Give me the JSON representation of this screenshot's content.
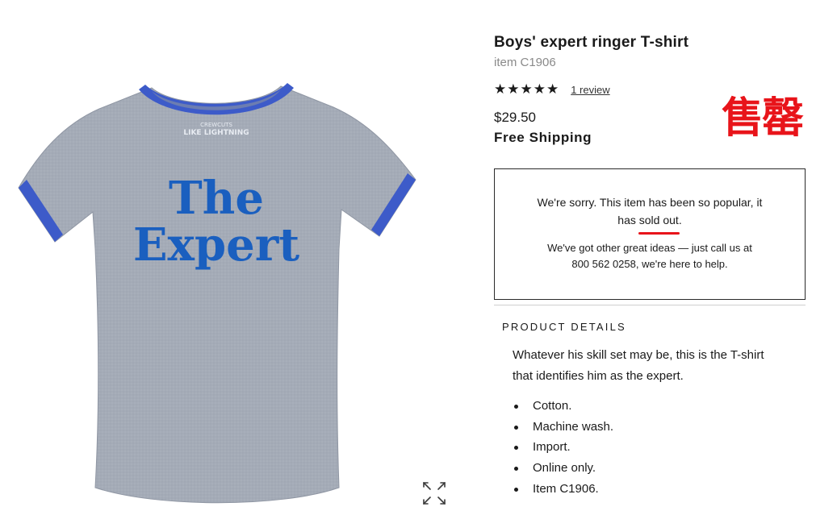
{
  "product": {
    "title": "Boys' expert ringer T-shirt",
    "item_code": "item C1906",
    "stars": "★★★★★",
    "rating": 5,
    "review_link": "1 review",
    "price": "$29.50",
    "shipping": "Free Shipping"
  },
  "stamp": "售罄",
  "soldout": {
    "line1_prefix": "We're sorry. This item has been so popular, it",
    "line2_prefix": "has ",
    "sold_out": "sold out",
    "line2_suffix": ".",
    "help_line1": "We've got other great ideas — just call us at",
    "help_line2": "800 562 0258, we're here to help."
  },
  "product_details": {
    "heading": "PRODUCT DETAILS",
    "description_line1": "Whatever his skill set may be, this is the T-shirt",
    "description_line2": "that identifies him as the expert.",
    "bullets": [
      "Cotton.",
      "Machine wash.",
      "Import.",
      "Online only.",
      "Item C1906."
    ]
  },
  "image": {
    "print_line1": "The",
    "print_line2": "Expert",
    "tag_line1": "CREWCUTS",
    "tag_line2": "LIKE LIGHTNING"
  },
  "colors": {
    "shirt": "#a4abb7",
    "trim": "#3d5bc9",
    "print": "#1a5fbf",
    "stamp": "#e8141a"
  },
  "icons": {
    "zoom": "expand-arrows-icon"
  }
}
